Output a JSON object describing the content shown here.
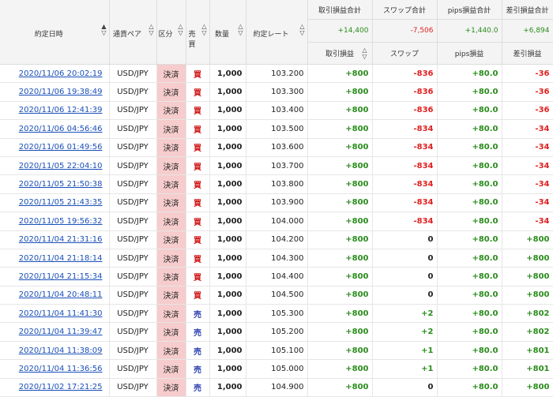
{
  "headers": {
    "date": "約定日時",
    "pair": "通貨ペア",
    "kbn": "区分",
    "side": "売買",
    "qty": "数量",
    "rate": "約定レート",
    "pl_total": "取引損益合計",
    "swap_total": "スワップ合計",
    "pips_total": "pips損益合計",
    "net_total": "差引損益合計",
    "pl": "取引損益",
    "swap": "スワップ",
    "pips": "pips損益",
    "net": "差引損益"
  },
  "totals": {
    "pl": "+14,400",
    "swap": "-7,506",
    "pips": "+1,440.0",
    "net": "+6,894"
  },
  "sort_icon": "sort-updown-icon",
  "colors": {
    "positive": "#2a8c1c",
    "negative": "#e02020",
    "buy": "#d01818",
    "sell": "#2a3fb0",
    "kbn_bg": "#f6cccc",
    "link": "#1a4fb8"
  },
  "rows": [
    {
      "date": "2020/11/06 20:02:19",
      "pair": "USD/JPY",
      "kbn": "決済",
      "side": "買",
      "qty": "1,000",
      "rate": "103.200",
      "pl": "+800",
      "swap": "-836",
      "pips": "+80.0",
      "net": "-36"
    },
    {
      "date": "2020/11/06 19:38:49",
      "pair": "USD/JPY",
      "kbn": "決済",
      "side": "買",
      "qty": "1,000",
      "rate": "103.300",
      "pl": "+800",
      "swap": "-836",
      "pips": "+80.0",
      "net": "-36"
    },
    {
      "date": "2020/11/06 12:41:39",
      "pair": "USD/JPY",
      "kbn": "決済",
      "side": "買",
      "qty": "1,000",
      "rate": "103.400",
      "pl": "+800",
      "swap": "-836",
      "pips": "+80.0",
      "net": "-36"
    },
    {
      "date": "2020/11/06 04:56:46",
      "pair": "USD/JPY",
      "kbn": "決済",
      "side": "買",
      "qty": "1,000",
      "rate": "103.500",
      "pl": "+800",
      "swap": "-834",
      "pips": "+80.0",
      "net": "-34"
    },
    {
      "date": "2020/11/06 01:49:56",
      "pair": "USD/JPY",
      "kbn": "決済",
      "side": "買",
      "qty": "1,000",
      "rate": "103.600",
      "pl": "+800",
      "swap": "-834",
      "pips": "+80.0",
      "net": "-34"
    },
    {
      "date": "2020/11/05 22:04:10",
      "pair": "USD/JPY",
      "kbn": "決済",
      "side": "買",
      "qty": "1,000",
      "rate": "103.700",
      "pl": "+800",
      "swap": "-834",
      "pips": "+80.0",
      "net": "-34"
    },
    {
      "date": "2020/11/05 21:50:38",
      "pair": "USD/JPY",
      "kbn": "決済",
      "side": "買",
      "qty": "1,000",
      "rate": "103.800",
      "pl": "+800",
      "swap": "-834",
      "pips": "+80.0",
      "net": "-34"
    },
    {
      "date": "2020/11/05 21:43:35",
      "pair": "USD/JPY",
      "kbn": "決済",
      "side": "買",
      "qty": "1,000",
      "rate": "103.900",
      "pl": "+800",
      "swap": "-834",
      "pips": "+80.0",
      "net": "-34"
    },
    {
      "date": "2020/11/05 19:56:32",
      "pair": "USD/JPY",
      "kbn": "決済",
      "side": "買",
      "qty": "1,000",
      "rate": "104.000",
      "pl": "+800",
      "swap": "-834",
      "pips": "+80.0",
      "net": "-34"
    },
    {
      "date": "2020/11/04 21:31:16",
      "pair": "USD/JPY",
      "kbn": "決済",
      "side": "買",
      "qty": "1,000",
      "rate": "104.200",
      "pl": "+800",
      "swap": "0",
      "pips": "+80.0",
      "net": "+800"
    },
    {
      "date": "2020/11/04 21:18:14",
      "pair": "USD/JPY",
      "kbn": "決済",
      "side": "買",
      "qty": "1,000",
      "rate": "104.300",
      "pl": "+800",
      "swap": "0",
      "pips": "+80.0",
      "net": "+800"
    },
    {
      "date": "2020/11/04 21:15:34",
      "pair": "USD/JPY",
      "kbn": "決済",
      "side": "買",
      "qty": "1,000",
      "rate": "104.400",
      "pl": "+800",
      "swap": "0",
      "pips": "+80.0",
      "net": "+800"
    },
    {
      "date": "2020/11/04 20:48:11",
      "pair": "USD/JPY",
      "kbn": "決済",
      "side": "買",
      "qty": "1,000",
      "rate": "104.500",
      "pl": "+800",
      "swap": "0",
      "pips": "+80.0",
      "net": "+800"
    },
    {
      "date": "2020/11/04 11:41:30",
      "pair": "USD/JPY",
      "kbn": "決済",
      "side": "売",
      "qty": "1,000",
      "rate": "105.300",
      "pl": "+800",
      "swap": "+2",
      "pips": "+80.0",
      "net": "+802"
    },
    {
      "date": "2020/11/04 11:39:47",
      "pair": "USD/JPY",
      "kbn": "決済",
      "side": "売",
      "qty": "1,000",
      "rate": "105.200",
      "pl": "+800",
      "swap": "+2",
      "pips": "+80.0",
      "net": "+802"
    },
    {
      "date": "2020/11/04 11:38:09",
      "pair": "USD/JPY",
      "kbn": "決済",
      "side": "売",
      "qty": "1,000",
      "rate": "105.100",
      "pl": "+800",
      "swap": "+1",
      "pips": "+80.0",
      "net": "+801"
    },
    {
      "date": "2020/11/04 11:36:56",
      "pair": "USD/JPY",
      "kbn": "決済",
      "side": "売",
      "qty": "1,000",
      "rate": "105.000",
      "pl": "+800",
      "swap": "+1",
      "pips": "+80.0",
      "net": "+801"
    },
    {
      "date": "2020/11/02 17:21:25",
      "pair": "USD/JPY",
      "kbn": "決済",
      "side": "売",
      "qty": "1,000",
      "rate": "104.900",
      "pl": "+800",
      "swap": "0",
      "pips": "+80.0",
      "net": "+800"
    }
  ]
}
